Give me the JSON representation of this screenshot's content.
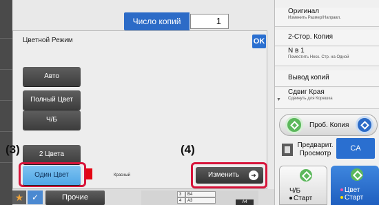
{
  "copies": {
    "label": "Число копий",
    "value": "1"
  },
  "dialog": {
    "title": "Цветной Режим",
    "ok_label": "OK",
    "modes": [
      "Авто",
      "Полный Цвет",
      "Ч/Б",
      "2 Цвета",
      "Один Цвет"
    ],
    "selected_mode": "Один Цвет",
    "single_color": {
      "name": "Красный",
      "swatch": "#e30613"
    },
    "change_label": "Изменить"
  },
  "callouts": {
    "left": "(3)",
    "right": "(4)"
  },
  "bottom": {
    "other_label": "Прочие",
    "trays": [
      {
        "num": "3",
        "size": "B4"
      },
      {
        "num": "4",
        "size": "A3"
      }
    ],
    "current_size": "A4"
  },
  "right_panel": {
    "items": [
      {
        "main": "Оригинал",
        "sub": "Изменить Размер/Направл."
      },
      {
        "main": "2-Стор. Копия",
        "sub": ""
      },
      {
        "main": "N в 1",
        "sub": "Поместить Неск. Стр. на Одной"
      },
      {
        "main": "Вывод копий",
        "sub": ""
      },
      {
        "main": "Сдвиг Края",
        "sub": "Сдвинуть для Корешка"
      }
    ],
    "preview_copy": "Проб. Копия",
    "preview_scan": "Предварит. Просмотр",
    "ca": "CA",
    "bw_start_line1": "Ч/Б",
    "bw_start_line2": "Старт",
    "color_start_line1": "Цвет",
    "color_start_line2": "Старт"
  },
  "colors": {
    "accent_blue": "#2c6bc7",
    "callout_red": "#d7143a",
    "selected_mode": "#5fb0ea",
    "green_start": "#5cb85c"
  }
}
